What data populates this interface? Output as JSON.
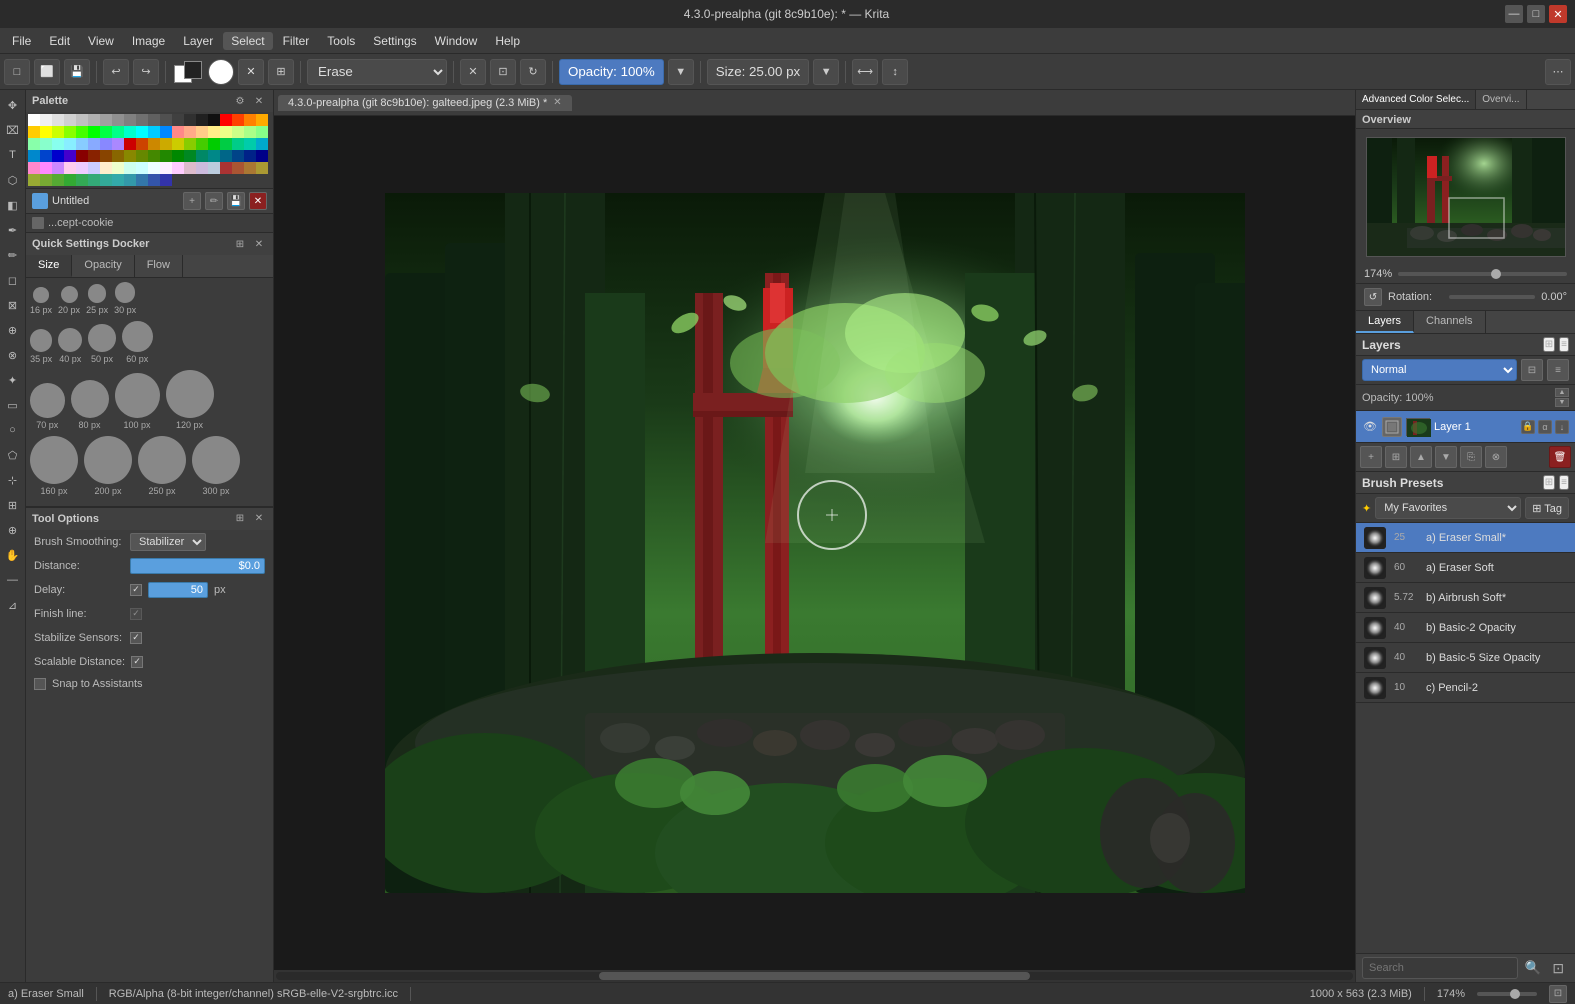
{
  "titleBar": {
    "title": "4.3.0-prealpha (git 8c9b10e): * — Krita",
    "minimize": "—",
    "maximize": "□",
    "close": "✕"
  },
  "menuBar": {
    "items": [
      "File",
      "Edit",
      "View",
      "Image",
      "Layer",
      "Select",
      "Filter",
      "Tools",
      "Settings",
      "Window",
      "Help"
    ]
  },
  "toolbar": {
    "brushName": "Erase",
    "opacity": "Opacity: 100%",
    "size": "Size: 25.00 px"
  },
  "leftPanel": {
    "paletteTitle": "Palette",
    "brushTitle": "Untitled",
    "brushCookie": "...cept-cookie",
    "quickSettingsTitle": "Quick Settings Docker",
    "tabs": [
      "Size",
      "Opacity",
      "Flow"
    ],
    "sizes": [
      {
        "size": 16,
        "label": "16 px"
      },
      {
        "size": 20,
        "label": "20 px"
      },
      {
        "size": 25,
        "label": "25 px"
      },
      {
        "size": 30,
        "label": "30 px"
      },
      {
        "size": 35,
        "label": "35 px"
      },
      {
        "size": 40,
        "label": "40 px"
      },
      {
        "size": 50,
        "label": "50 px"
      },
      {
        "size": 60,
        "label": "60 px"
      },
      {
        "size": 70,
        "label": "70 px"
      },
      {
        "size": 80,
        "label": "80 px"
      },
      {
        "size": 100,
        "label": "100 px"
      },
      {
        "size": 120,
        "label": "120 px"
      },
      {
        "size": 160,
        "label": "160 px"
      },
      {
        "size": 200,
        "label": "200 px"
      },
      {
        "size": 250,
        "label": "250 px"
      },
      {
        "size": 300,
        "label": "300 px"
      }
    ],
    "toolOptions": {
      "title": "Tool Options",
      "brushSmoothing": "Brush Smoothing:",
      "brushSmoothingValue": "Stabilizer",
      "distance": "Distance:",
      "distanceValue": "$0.0",
      "delay": "Delay:",
      "delayValue": "50",
      "delayUnit": "px",
      "finishLine": "Finish line:",
      "stabilizeSensors": "Stabilize Sensors:",
      "scalableDistance": "Scalable Distance:"
    },
    "snapToAssistants": "Snap to Assistants"
  },
  "canvas": {
    "tabTitle": "4.3.0-prealpha (git 8c9b10e): galteed.jpeg (2.3 MiB) *"
  },
  "rightPanel": {
    "tabs": [
      "Advanced Color Selec...",
      "Overvi..."
    ],
    "overview": {
      "title": "Overview"
    },
    "rotation": {
      "label": "Rotation:",
      "value": "0.00°"
    },
    "layers": {
      "tabs": [
        "Layers",
        "Channels"
      ],
      "title": "Layers",
      "blendMode": "Normal",
      "opacityLabel": "Opacity: 100%",
      "layer1Name": "Layer 1"
    },
    "brushPresets": {
      "title": "Brush Presets",
      "favoritesLabel": "✦ My Favorites",
      "tagLabel": "⊞ Tag",
      "items": [
        {
          "num": "25",
          "name": "a) Eraser Small*",
          "active": true
        },
        {
          "num": "60",
          "name": "a) Eraser Soft",
          "active": false
        },
        {
          "num": "5.72",
          "name": "b) Airbrush Soft*",
          "active": false
        },
        {
          "num": "40",
          "name": "b) Basic-2 Opacity",
          "active": false
        },
        {
          "num": "40",
          "name": "b) Basic-5 Size Opacity",
          "active": false
        },
        {
          "num": "10",
          "name": "c) Pencil-2",
          "active": false
        }
      ],
      "searchPlaceholder": "Search"
    }
  },
  "statusBar": {
    "brushName": "a) Eraser Small",
    "colorMode": "RGB/Alpha (8-bit integer/channel)  sRGB-elle-V2-srgbtrc.icc",
    "dimensions": "1000 x 563 (2.3 MiB)",
    "zoom": "174%"
  },
  "paletteColors": [
    "#ffffff",
    "#f0f0f0",
    "#e0e0e0",
    "#d0d0d0",
    "#c0c0c0",
    "#b0b0b0",
    "#a0a0a0",
    "#909090",
    "#808080",
    "#707070",
    "#606060",
    "#505050",
    "#404040",
    "#303030",
    "#202020",
    "#101010",
    "#ff0000",
    "#ff4000",
    "#ff8000",
    "#ffaa00",
    "#ffcc00",
    "#ffff00",
    "#ccff00",
    "#88ff00",
    "#44ff00",
    "#00ff00",
    "#00ff44",
    "#00ff88",
    "#00ffcc",
    "#00ffff",
    "#00ccff",
    "#0088ff",
    "#ff8888",
    "#ffaa88",
    "#ffcc88",
    "#ffee88",
    "#eeff88",
    "#ccff88",
    "#aaff88",
    "#88ff88",
    "#88ffaa",
    "#88ffcc",
    "#88ffee",
    "#88eeff",
    "#88ccff",
    "#88aaff",
    "#8888ff",
    "#aa88ff",
    "#cc0000",
    "#cc4400",
    "#cc8800",
    "#ccaa00",
    "#cccc00",
    "#88cc00",
    "#44cc00",
    "#00cc00",
    "#00cc44",
    "#00cc88",
    "#00ccaa",
    "#00aacc",
    "#0088cc",
    "#0044cc",
    "#0000cc",
    "#4400cc",
    "#880000",
    "#882200",
    "#884400",
    "#886600",
    "#888800",
    "#668800",
    "#448800",
    "#228800",
    "#008800",
    "#008822",
    "#008866",
    "#008888",
    "#006688",
    "#004488",
    "#002288",
    "#000088",
    "#ff88cc",
    "#ff88ff",
    "#cc88ff",
    "#ffccee",
    "#eeccff",
    "#ccccff",
    "#ffeecc",
    "#eeffcc",
    "#ccffee",
    "#ccffff",
    "#eeffff",
    "#ffeeff",
    "#ffccff",
    "#ddbbcc",
    "#ccbbdd",
    "#bbccdd",
    "#aa3333",
    "#aa5533",
    "#aa7733",
    "#aa9933",
    "#99aa33",
    "#77aa33",
    "#55aa33",
    "#33aa33",
    "#33aa55",
    "#33aa77",
    "#33aa99",
    "#33aaaa",
    "#3399aa",
    "#3377aa",
    "#3355aa",
    "#3333aa"
  ]
}
